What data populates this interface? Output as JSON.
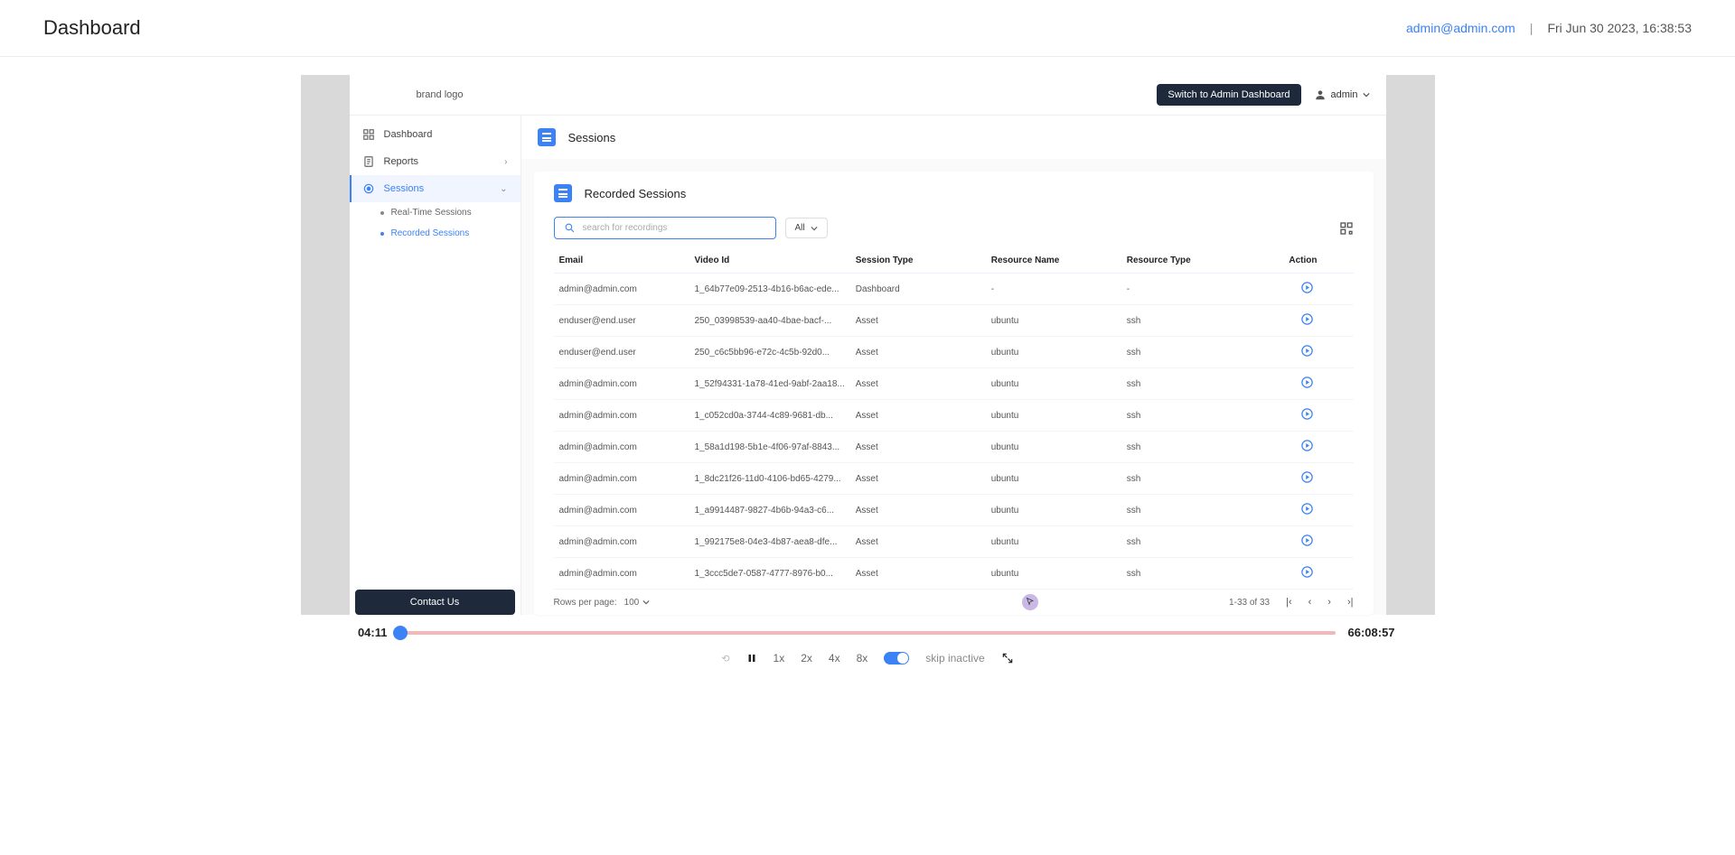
{
  "top": {
    "title": "Dashboard",
    "email": "admin@admin.com",
    "separator": "|",
    "datetime": "Fri Jun 30 2023, 16:38:53"
  },
  "app": {
    "brand": "brand logo",
    "switch_button": "Switch to Admin Dashboard",
    "user_name": "admin"
  },
  "sidebar": {
    "dashboard": "Dashboard",
    "reports": "Reports",
    "sessions": "Sessions",
    "realtime": "Real-Time Sessions",
    "recorded": "Recorded Sessions",
    "contact": "Contact Us"
  },
  "page": {
    "title": "Sessions",
    "panel_title": "Recorded Sessions",
    "search_placeholder": "search for recordings",
    "filter_all": "All"
  },
  "table": {
    "headers": {
      "email": "Email",
      "video_id": "Video Id",
      "session_type": "Session Type",
      "resource_name": "Resource Name",
      "resource_type": "Resource Type",
      "action": "Action"
    },
    "rows": [
      {
        "email": "admin@admin.com",
        "video_id": "1_64b77e09-2513-4b16-b6ac-ede...",
        "session_type": "Dashboard",
        "resource_name": "-",
        "resource_type": "-"
      },
      {
        "email": "enduser@end.user",
        "video_id": "250_03998539-aa40-4bae-bacf-...",
        "session_type": "Asset",
        "resource_name": "ubuntu",
        "resource_type": "ssh"
      },
      {
        "email": "enduser@end.user",
        "video_id": "250_c6c5bb96-e72c-4c5b-92d0...",
        "session_type": "Asset",
        "resource_name": "ubuntu",
        "resource_type": "ssh"
      },
      {
        "email": "admin@admin.com",
        "video_id": "1_52f94331-1a78-41ed-9abf-2aa18...",
        "session_type": "Asset",
        "resource_name": "ubuntu",
        "resource_type": "ssh"
      },
      {
        "email": "admin@admin.com",
        "video_id": "1_c052cd0a-3744-4c89-9681-db...",
        "session_type": "Asset",
        "resource_name": "ubuntu",
        "resource_type": "ssh"
      },
      {
        "email": "admin@admin.com",
        "video_id": "1_58a1d198-5b1e-4f06-97af-8843...",
        "session_type": "Asset",
        "resource_name": "ubuntu",
        "resource_type": "ssh"
      },
      {
        "email": "admin@admin.com",
        "video_id": "1_8dc21f26-11d0-4106-bd65-4279...",
        "session_type": "Asset",
        "resource_name": "ubuntu",
        "resource_type": "ssh"
      },
      {
        "email": "admin@admin.com",
        "video_id": "1_a9914487-9827-4b6b-94a3-c6...",
        "session_type": "Asset",
        "resource_name": "ubuntu",
        "resource_type": "ssh"
      },
      {
        "email": "admin@admin.com",
        "video_id": "1_992175e8-04e3-4b87-aea8-dfe...",
        "session_type": "Asset",
        "resource_name": "ubuntu",
        "resource_type": "ssh"
      },
      {
        "email": "admin@admin.com",
        "video_id": "1_3ccc5de7-0587-4777-8976-b0...",
        "session_type": "Asset",
        "resource_name": "ubuntu",
        "resource_type": "ssh"
      }
    ]
  },
  "pagination": {
    "rows_per_page_label": "Rows per page:",
    "rows_per_page_value": "100",
    "range": "1-33 of 33"
  },
  "player": {
    "current_time": "04:11",
    "total_time": "66:08:57",
    "speeds": {
      "x1": "1x",
      "x2": "2x",
      "x4": "4x",
      "x8": "8x"
    },
    "skip_label": "skip inactive"
  }
}
